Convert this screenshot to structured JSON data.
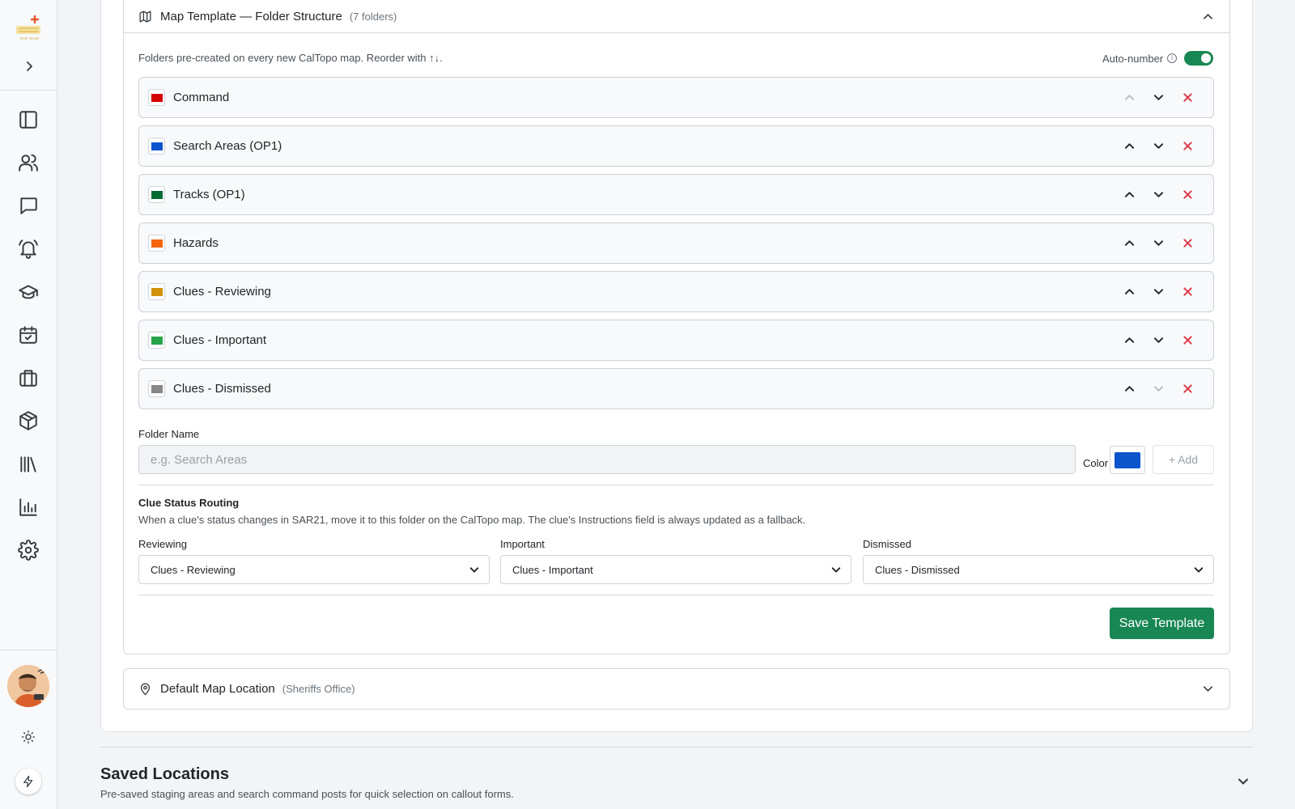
{
  "sidebar": {
    "logo_text": "SAR TEAM",
    "nav_items": [
      {
        "icon": "sidebar-panel-icon"
      },
      {
        "icon": "users-icon"
      },
      {
        "icon": "chat-icon"
      },
      {
        "icon": "bell-alert-icon"
      },
      {
        "icon": "graduation-cap-icon"
      },
      {
        "icon": "calendar-check-icon"
      },
      {
        "icon": "briefcase-icon"
      },
      {
        "icon": "box-icon"
      },
      {
        "icon": "library-icon"
      },
      {
        "icon": "bar-chart-icon"
      },
      {
        "icon": "gear-icon"
      }
    ]
  },
  "template_panel": {
    "title": "Map Template — Folder Structure",
    "subtitle": "(7 folders)",
    "helper": "Folders pre-created on every new CalTopo map. Reorder with ↑↓.",
    "auto_number_label": "Auto-number",
    "auto_number_on": true,
    "folders": [
      {
        "name": "Command",
        "color": "#d40000",
        "up_disabled": true,
        "down_disabled": false
      },
      {
        "name": "Search Areas (OP1)",
        "color": "#0a54cc",
        "up_disabled": false,
        "down_disabled": false
      },
      {
        "name": "Tracks (OP1)",
        "color": "#006b33",
        "up_disabled": false,
        "down_disabled": false
      },
      {
        "name": "Hazards",
        "color": "#f5650d",
        "up_disabled": false,
        "down_disabled": false
      },
      {
        "name": "Clues - Reviewing",
        "color": "#d4920c",
        "up_disabled": false,
        "down_disabled": false
      },
      {
        "name": "Clues - Important",
        "color": "#26a34a",
        "up_disabled": false,
        "down_disabled": false
      },
      {
        "name": "Clues - Dismissed",
        "color": "#888888",
        "up_disabled": false,
        "down_disabled": true
      }
    ],
    "folder_name_label": "Folder Name",
    "folder_name_placeholder": "e.g. Search Areas",
    "color_label": "Color",
    "new_color": "#0a54cc",
    "add_label": "+ Add",
    "routing": {
      "title": "Clue Status Routing",
      "description": "When a clue's status changes in SAR21, move it to this folder on the CalTopo map. The clue's Instructions field is always updated as a fallback.",
      "fields": [
        {
          "label": "Reviewing",
          "value": "Clues - Reviewing"
        },
        {
          "label": "Important",
          "value": "Clues - Important"
        },
        {
          "label": "Dismissed",
          "value": "Clues - Dismissed"
        }
      ]
    },
    "save_label": "Save Template"
  },
  "location_panel": {
    "title": "Default Map Location",
    "subtitle": "(Sheriffs Office)"
  },
  "saved_locations": {
    "title": "Saved Locations",
    "description": "Pre-saved staging areas and search command posts for quick selection on callout forms."
  },
  "colors": {
    "accent_green": "#198754",
    "danger_red": "#dc3545"
  }
}
